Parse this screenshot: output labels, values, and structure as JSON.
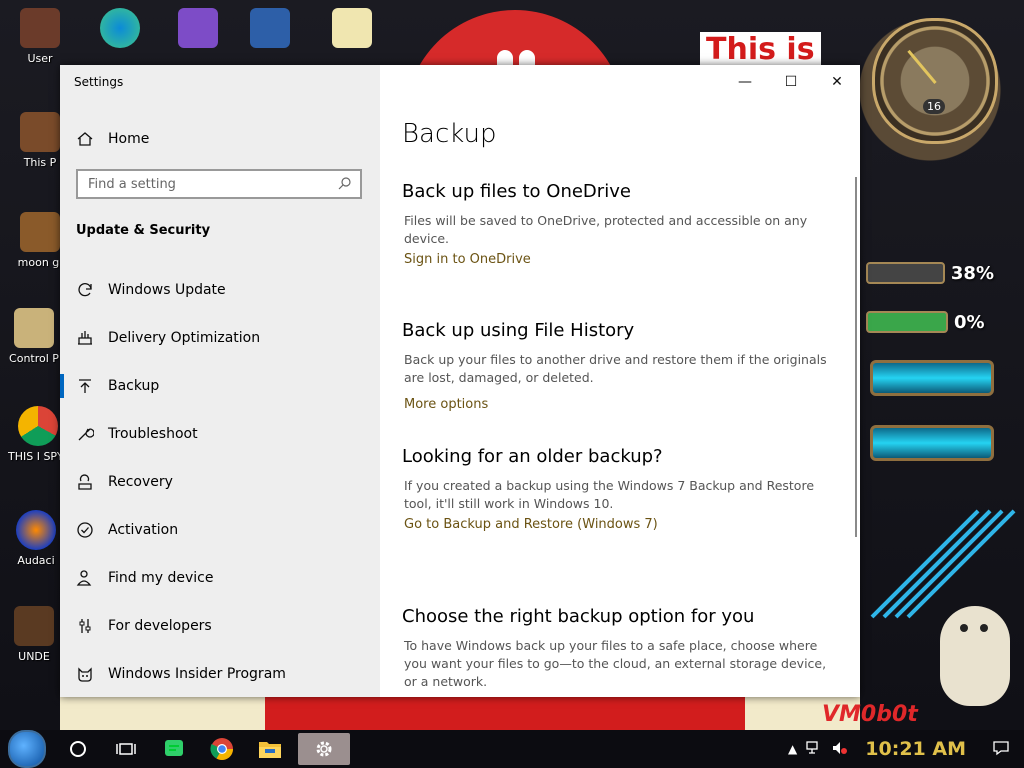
{
  "colors": {
    "accent": "#0067c0",
    "link": "#6b5313",
    "sidebar_bg": "#eeeeee",
    "taskbar_bg": "#0c0c11"
  },
  "desktop": {
    "deco_title": "This is",
    "deco_signature": "VM0b0t",
    "icons": [
      {
        "label": "User",
        "icon": "folder-icon"
      },
      {
        "label": "This P",
        "icon": "computer-icon"
      },
      {
        "label": "moon gi",
        "icon": "folder-icon"
      },
      {
        "label": "Control P",
        "icon": "control-panel-icon"
      },
      {
        "label": "THIS I SPYWA",
        "icon": "chrome-icon"
      },
      {
        "label": "Audaci",
        "icon": "audacity-icon"
      },
      {
        "label": "UNDE",
        "icon": "app-icon"
      }
    ],
    "gauges": [
      "38%",
      "0%"
    ],
    "clock_badge": "16"
  },
  "window": {
    "title": "Settings",
    "controls": {
      "minimize": "—",
      "maximize": "☐",
      "close": "✕"
    }
  },
  "sidebar": {
    "home_label": "Home",
    "search_placeholder": "Find a setting",
    "section": "Update & Security",
    "items": [
      {
        "label": "Windows Update",
        "icon": "refresh-icon"
      },
      {
        "label": "Delivery Optimization",
        "icon": "delivery-optimization-icon"
      },
      {
        "label": "Backup",
        "icon": "backup-arrow-icon",
        "active": true
      },
      {
        "label": "Troubleshoot",
        "icon": "wrench-icon"
      },
      {
        "label": "Recovery",
        "icon": "recovery-icon"
      },
      {
        "label": "Activation",
        "icon": "check-circle-icon"
      },
      {
        "label": "Find my device",
        "icon": "person-pin-icon"
      },
      {
        "label": "For developers",
        "icon": "developer-sliders-icon"
      },
      {
        "label": "Windows Insider Program",
        "icon": "insider-cat-icon"
      }
    ]
  },
  "main": {
    "title": "Backup",
    "onedrive": {
      "heading": "Back up files to OneDrive",
      "desc": "Files will be saved to OneDrive, protected and accessible on any device.",
      "link": "Sign in to OneDrive"
    },
    "file_history": {
      "heading": "Back up using File History",
      "desc": "Back up your files to another drive and restore them if the originals are lost, damaged, or deleted.",
      "link": "More options"
    },
    "older": {
      "heading": "Looking for an older backup?",
      "desc": "If you created a backup using the Windows 7 Backup and Restore tool, it'll still work in Windows 10.",
      "link": "Go to Backup and Restore (Windows 7)"
    },
    "choose": {
      "heading": "Choose the right backup option for you",
      "desc": "To have Windows back up your files to a safe place, choose where you want your files to go—to the cloud, an external storage device, or a network."
    }
  },
  "taskbar": {
    "items": [
      "start-button",
      "cortana-icon",
      "task-view-icon",
      "sticky-app-icon",
      "chrome-icon",
      "file-explorer-icon",
      "settings-gear-icon"
    ],
    "time": "10:21 AM"
  }
}
